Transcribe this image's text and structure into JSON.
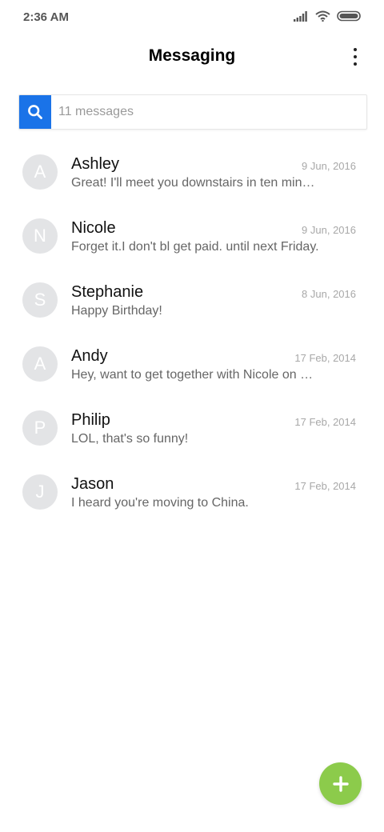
{
  "status_bar": {
    "time": "2:36 AM"
  },
  "header": {
    "title": "Messaging"
  },
  "search": {
    "placeholder": "11 messages"
  },
  "conversations": [
    {
      "initial": "A",
      "name": "Ashley",
      "date": "9 Jun, 2016",
      "preview": "Great! I'll meet you downstairs in ten minutes."
    },
    {
      "initial": "N",
      "name": "Nicole",
      "date": "9 Jun, 2016",
      "preview": "Forget it.I don't bl get paid. until next Friday."
    },
    {
      "initial": "S",
      "name": "Stephanie",
      "date": "8 Jun, 2016",
      "preview": "Happy Birthday!"
    },
    {
      "initial": "A",
      "name": "Andy",
      "date": "17 Feb, 2014",
      "preview": "Hey, want to get together with Nicole on Friday?"
    },
    {
      "initial": "P",
      "name": "Philip",
      "date": "17 Feb, 2014",
      "preview": "LOL, that's so funny!"
    },
    {
      "initial": "J",
      "name": "Jason",
      "date": "17 Feb, 2014",
      "preview": "I heard you're moving to China."
    }
  ],
  "colors": {
    "accent": "#1a73e8",
    "fab": "#8ccb4b",
    "avatar_bg": "#e3e4e6"
  },
  "icons": {
    "search": "search-icon",
    "fab": "plus-icon",
    "menu": "more-vert-icon"
  }
}
